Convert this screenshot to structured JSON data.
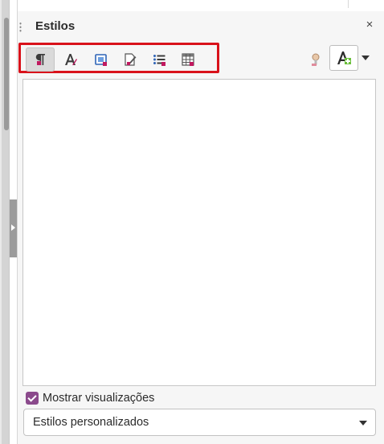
{
  "panel": {
    "title": "Estilos",
    "close_glyph": "×"
  },
  "toolbar": {
    "style_categories": [
      {
        "icon": "paragraph-styles-icon",
        "active": true
      },
      {
        "icon": "character-styles-icon",
        "active": false
      },
      {
        "icon": "frame-styles-icon",
        "active": false
      },
      {
        "icon": "page-styles-icon",
        "active": false
      },
      {
        "icon": "list-styles-icon",
        "active": false
      },
      {
        "icon": "table-styles-icon",
        "active": false
      }
    ],
    "fill_format_icon": "fill-format-mode-icon",
    "new_style_icon": "new-style-from-selection-icon",
    "new_style_menu_icon": "dropdown-arrow-icon"
  },
  "footer": {
    "show_previews_label": "Mostrar visualizações",
    "show_previews_checked": true,
    "filter_value": "Estilos personalizados"
  },
  "colors": {
    "highlight": "#d9121b",
    "checkbox": "#8b4a8c"
  }
}
